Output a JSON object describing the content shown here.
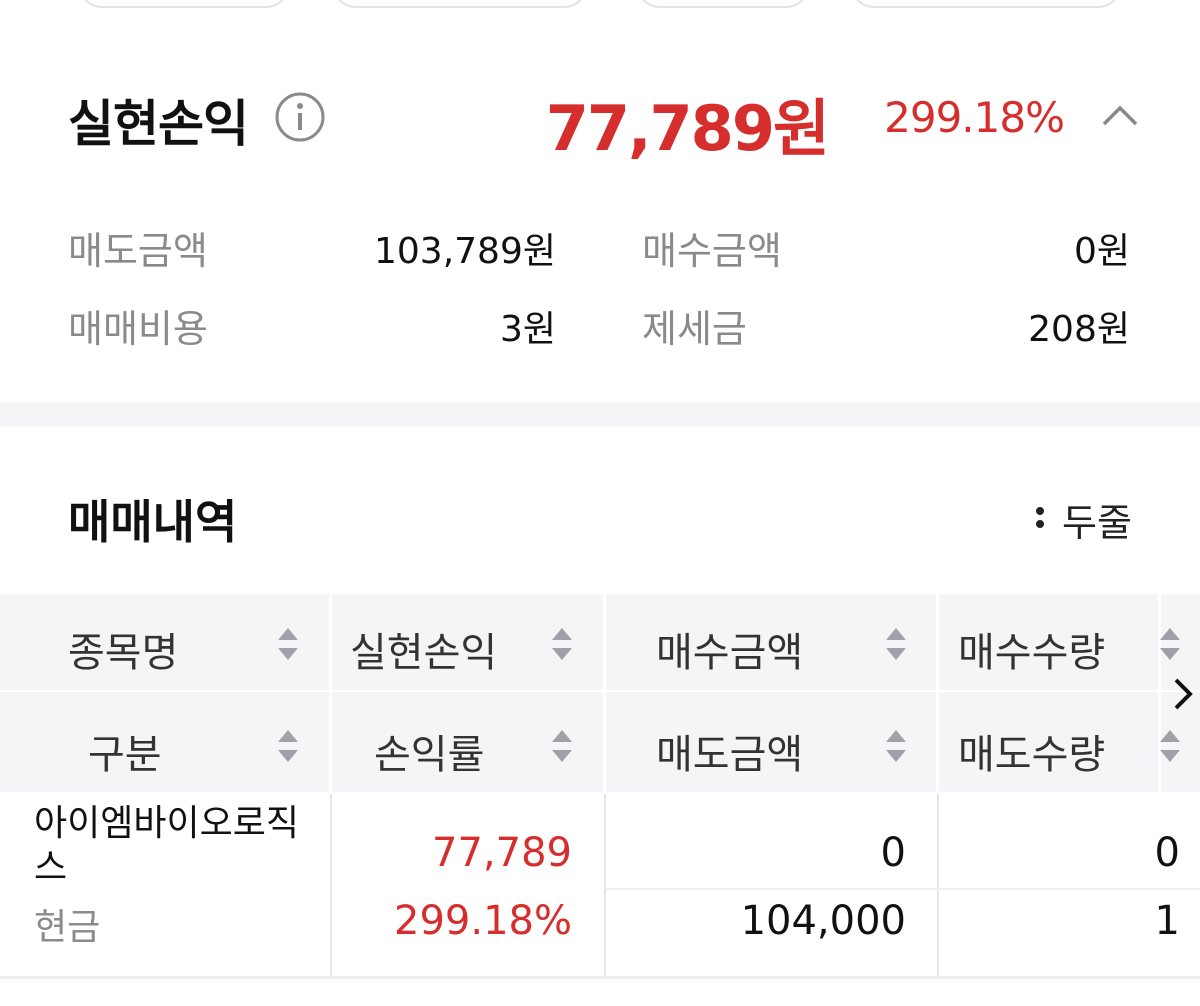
{
  "realized_pl": {
    "title": "실현손익",
    "amount": "77,789원",
    "rate": "299.18%"
  },
  "summary": {
    "sell_amount_label": "매도금액",
    "sell_amount_value": "103,789원",
    "buy_amount_label": "매수금액",
    "buy_amount_value": "0원",
    "trade_cost_label": "매매비용",
    "trade_cost_value": "3원",
    "tax_label": "제세금",
    "tax_value": "208원"
  },
  "trades": {
    "title": "매매내역",
    "view_mode": "두줄",
    "headers_row1": [
      "종목명",
      "실현손익",
      "매수금액",
      "매수수량"
    ],
    "headers_row2": [
      "구분",
      "손익률",
      "매도금액",
      "매도수량"
    ],
    "rows": [
      {
        "name": "아이엠바이오로직스",
        "type": "현금",
        "realized_pl": "77,789",
        "pl_rate": "299.18%",
        "buy_amount": "0",
        "sell_amount": "104,000",
        "buy_qty": "0",
        "sell_qty": "1"
      }
    ]
  },
  "colors": {
    "accent_red": "#d62d2d",
    "label_gray": "#8a8a8a",
    "header_bg": "#f5f5f7"
  }
}
